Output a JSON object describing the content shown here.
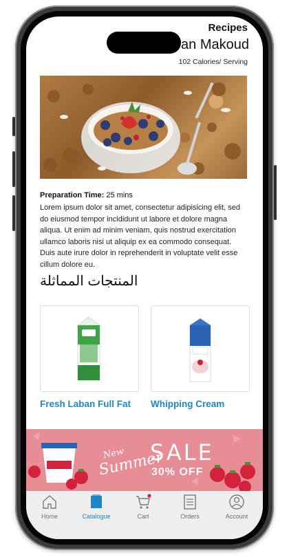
{
  "header": {
    "title": "Recipes",
    "recipe_name": "Laban Makoud",
    "calories": "102 Calories/ Serving"
  },
  "recipe": {
    "prep_label": "Preparation Time:",
    "prep_time": "25 mins",
    "description": "Lorem ipsum dolor sit amet, consectetur adipisicing elit, sed do eiusmod tempor incididunt ut labore et dolore magna aliqua. Ut enim ad minim veniam, quis nostrud exercitation ullamco laboris nisi ut aliquip ex ea commodo consequat. Duis aute irure dolor in reprehenderit in voluptate velit esse cillum dolore eu."
  },
  "section": {
    "heading": "المنتجات المماثلة"
  },
  "products": [
    {
      "name": "Fresh Laban Full Fat"
    },
    {
      "name": "Whipping Cream"
    }
  ],
  "banner": {
    "new": "New",
    "summer": "Summer",
    "sale": "SALE",
    "off": "30% OFF"
  },
  "tabs": [
    {
      "label": "Home",
      "icon": "home-icon"
    },
    {
      "label": "Catalogue",
      "icon": "catalogue-icon"
    },
    {
      "label": "Cart",
      "icon": "cart-icon"
    },
    {
      "label": "Orders",
      "icon": "orders-icon"
    },
    {
      "label": "Account",
      "icon": "account-icon"
    }
  ],
  "colors": {
    "accent": "#1d87c6",
    "banner": "#e78d95",
    "tabbar": "#eeeeee"
  }
}
